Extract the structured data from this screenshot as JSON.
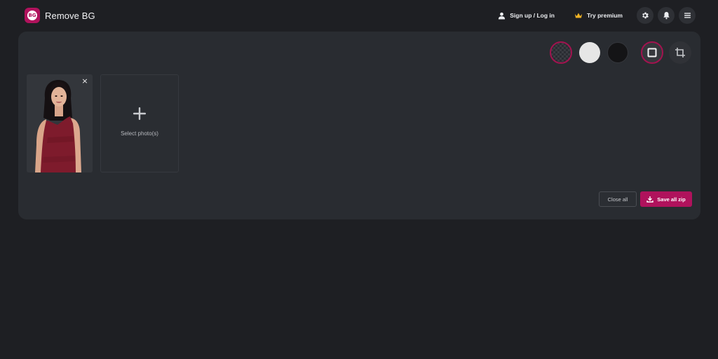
{
  "app": {
    "logo_mark": "BG",
    "title": "Remove BG"
  },
  "nav": {
    "signup_label": "Sign up / Log in",
    "premium_label": "Try premium",
    "icons": [
      "user-icon",
      "crown-icon",
      "gear-icon",
      "bell-icon",
      "menu-icon"
    ]
  },
  "toolbar": {
    "background_options": [
      "transparent",
      "white",
      "black"
    ],
    "selected_background": "transparent",
    "colors": {
      "accent": "#b0125c",
      "white_swatch": "#e6e6e6",
      "black_swatch": "#141416"
    },
    "tools": [
      "frame-icon",
      "crop-icon"
    ],
    "selected_tool": "frame"
  },
  "gallery": {
    "close_symbol": "×",
    "add_label": "Select photo(s)"
  },
  "actions": {
    "close_all_label": "Close all",
    "save_zip_label": "Save all zip"
  }
}
